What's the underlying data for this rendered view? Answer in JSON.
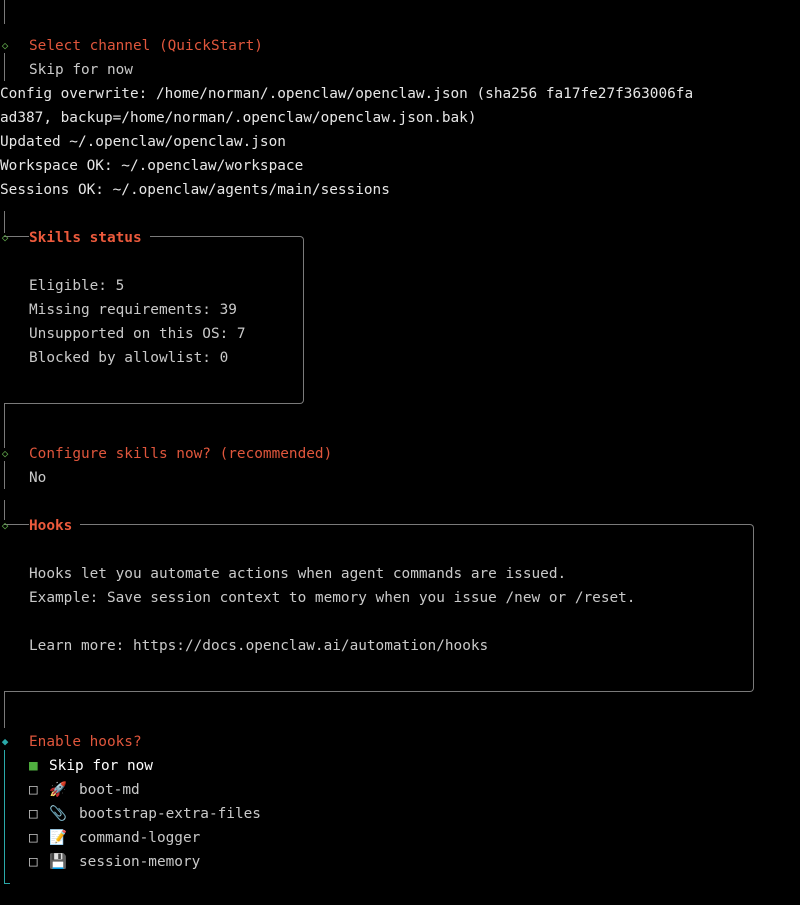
{
  "select_channel": {
    "prompt": "Select channel (QuickStart)",
    "answer": "Skip for now"
  },
  "log": [
    "Config overwrite: /home/norman/.openclaw/openclaw.json (sha256 fa17fe27f363006fa",
    "ad387, backup=/home/norman/.openclaw/openclaw.json.bak)",
    "Updated ~/.openclaw/openclaw.json",
    "Workspace OK: ~/.openclaw/workspace",
    "Sessions OK: ~/.openclaw/agents/main/sessions"
  ],
  "skills_status": {
    "title": "Skills status",
    "lines": [
      "Eligible: 5",
      "Missing requirements: 39",
      "Unsupported on this OS: 7",
      "Blocked by allowlist: 0"
    ]
  },
  "configure_skills": {
    "prompt": "Configure skills now? (recommended)",
    "answer": "No"
  },
  "hooks": {
    "title": "Hooks",
    "line1": "Hooks let you automate actions when agent commands are issued.",
    "line2": "Example: Save session context to memory when you issue /new or /reset.",
    "line3": "Learn more: https://docs.openclaw.ai/automation/hooks"
  },
  "enable_hooks": {
    "prompt": "Enable hooks?",
    "options": [
      {
        "check": "■",
        "icon": "",
        "label": "Skip for now"
      },
      {
        "check": "□",
        "icon": "🚀",
        "label": "boot-md"
      },
      {
        "check": "□",
        "icon": "📎",
        "label": "bootstrap-extra-files"
      },
      {
        "check": "□",
        "icon": "📝",
        "label": "command-logger"
      },
      {
        "check": "□",
        "icon": "💾",
        "label": "session-memory"
      }
    ]
  },
  "colors": {
    "prompt": "#e0563c",
    "rail": "#7a7a7a",
    "active_rail": "#2aa9a9",
    "diamond": "#5fa34a",
    "checked": "#4fae3f"
  }
}
